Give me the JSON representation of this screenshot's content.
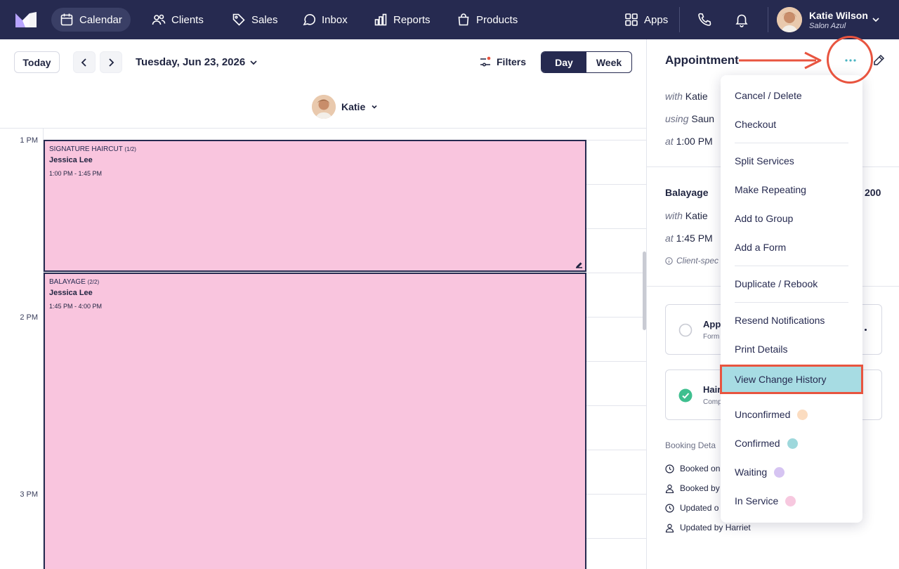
{
  "nav": {
    "items": [
      {
        "label": "Calendar",
        "icon": "calendar-icon",
        "active": true
      },
      {
        "label": "Clients",
        "icon": "users-icon"
      },
      {
        "label": "Sales",
        "icon": "tag-icon"
      },
      {
        "label": "Inbox",
        "icon": "inbox-icon"
      },
      {
        "label": "Reports",
        "icon": "bar-chart-icon"
      },
      {
        "label": "Products",
        "icon": "shopping-bag-icon"
      }
    ],
    "apps_label": "Apps",
    "user_name": "Katie Wilson",
    "user_salon": "Salon Azul"
  },
  "toolbar": {
    "today_label": "Today",
    "date_label": "Tuesday, Jun 23, 2026",
    "filters_label": "Filters",
    "view_day": "Day",
    "view_week": "Week",
    "staff_name": "Katie"
  },
  "calendar": {
    "time_labels": [
      "1 PM",
      "2 PM",
      "3 PM"
    ],
    "appointments": [
      {
        "service": "SIGNATURE HAIRCUT",
        "part": "(1/2)",
        "client": "Jessica Lee",
        "time": "1:00 PM - 1:45 PM"
      },
      {
        "service": "BALAYAGE",
        "part": "(2/2)",
        "client": "Jessica Lee",
        "time": "1:45 PM - 4:00 PM"
      }
    ]
  },
  "panel": {
    "title": "Appointment",
    "svc1_with_prefix": "with",
    "svc1_with": "Katie",
    "svc1_using_prefix": "using",
    "svc1_using": "Saun",
    "svc1_at_prefix": "at",
    "svc1_at": "1:00 PM",
    "svc2_name": "Balayage",
    "svc2_price": "200",
    "svc2_with_prefix": "with",
    "svc2_with": "Katie",
    "svc2_at_prefix": "at",
    "svc2_at": "1:45 PM",
    "client_note": "Client-spec",
    "form1_title": "App",
    "form1_sub": "Form",
    "form2_title": "Hair",
    "form2_sub": "Comp",
    "booking_title": "Booking Deta",
    "booked_on": "Booked on",
    "booked_by": "Booked by",
    "updated_on": "Updated o",
    "updated_by": "Updated by Harriet"
  },
  "menu": {
    "items": [
      "Cancel / Delete",
      "Checkout",
      "Split Services",
      "Make Repeating",
      "Add to Group",
      "Add a Form",
      "Duplicate / Rebook",
      "Resend Notifications",
      "Print Details",
      "View Change History"
    ],
    "statuses": [
      {
        "label": "Unconfirmed",
        "color": "#fbdcc0"
      },
      {
        "label": "Confirmed",
        "color": "#9ed8dc"
      },
      {
        "label": "Waiting",
        "color": "#d6c4f2"
      },
      {
        "label": "In Service",
        "color": "#f7c8df"
      }
    ]
  },
  "colors": {
    "nav_bg": "#262a50",
    "appointment_bg": "#f9c5de",
    "highlight_bg": "#a7dce3",
    "annotation_red": "#e8543f"
  }
}
